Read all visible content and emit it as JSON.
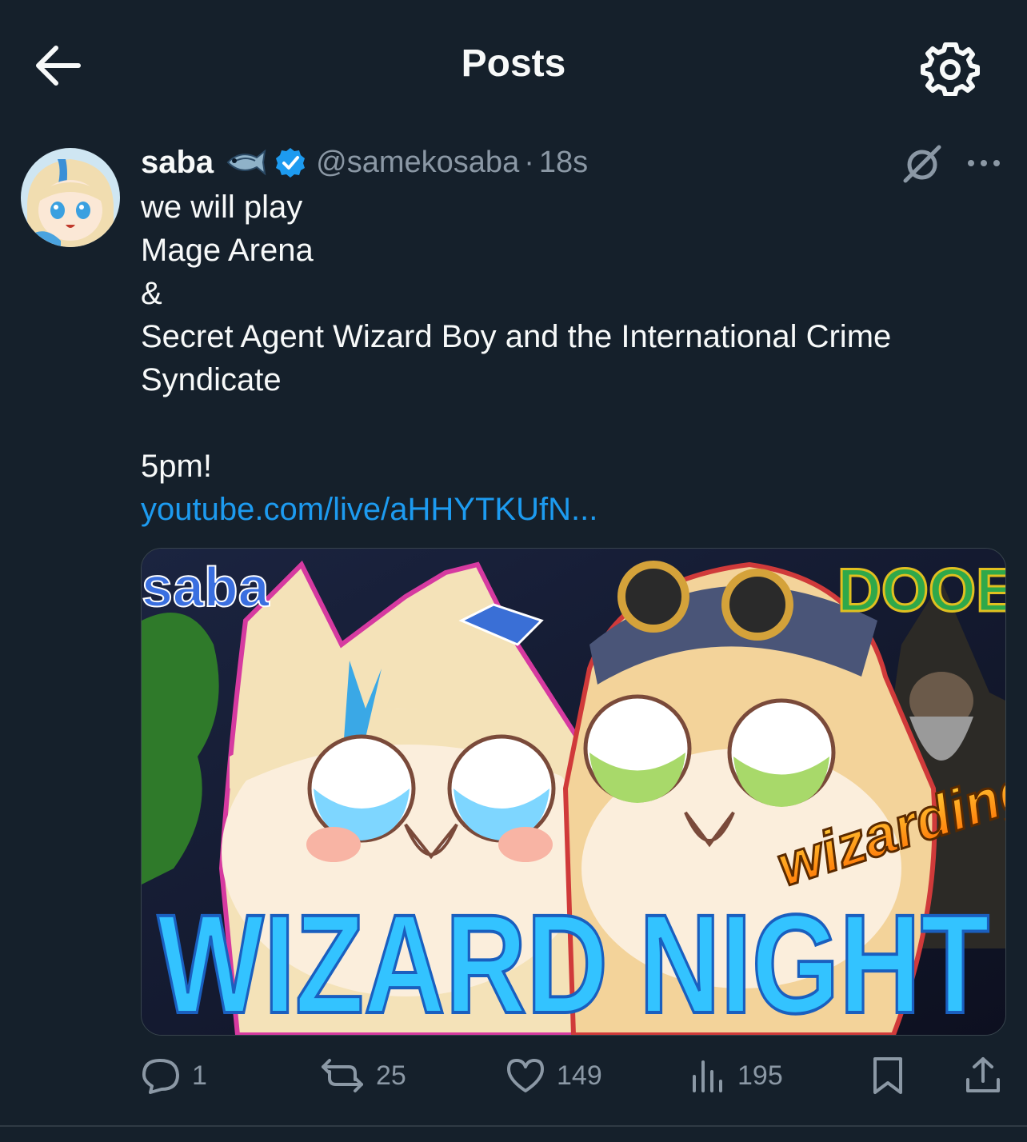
{
  "header": {
    "title": "Posts"
  },
  "post": {
    "author_name": "saba",
    "handle": "@samekosaba",
    "separator": "·",
    "time": "18s",
    "lines": [
      "we will play",
      "Mage Arena",
      "&",
      "Secret Agent Wizard Boy and the International Crime Syndicate",
      "",
      "5pm!"
    ],
    "link_text": "youtube.com/live/aHHYTKUfN...",
    "thumbnail": {
      "corner_left": "saba",
      "corner_right": "DOOE",
      "subtitle": "wizarding",
      "headline": "WIZARD NIGHT"
    }
  },
  "actions": {
    "replies": "1",
    "reposts": "25",
    "likes": "149",
    "views": "195"
  },
  "colors": {
    "background": "#15202b",
    "accent": "#1d9bf0",
    "muted": "#8b98a5",
    "text": "#e7e9ea"
  }
}
